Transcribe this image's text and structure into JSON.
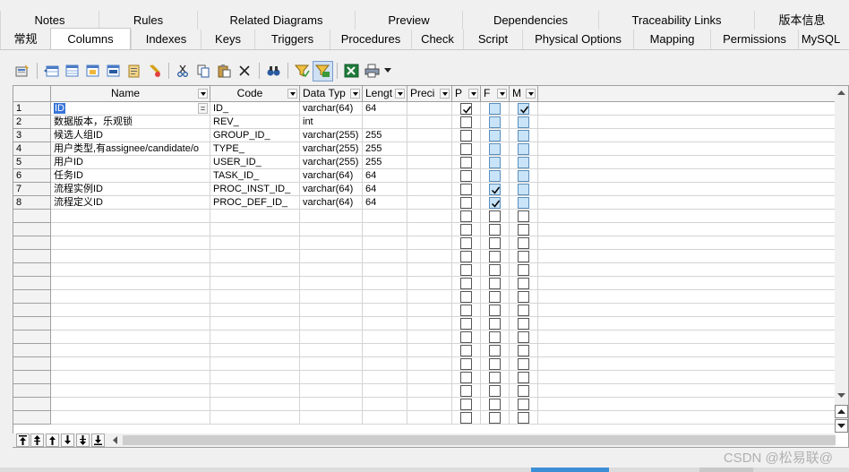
{
  "tabs_row1": [
    "Notes",
    "Rules",
    "Related Diagrams",
    "Preview",
    "Dependencies",
    "Traceability Links",
    "版本信息"
  ],
  "tabs_row2": [
    "常规",
    "Columns",
    "Indexes",
    "Keys",
    "Triggers",
    "Procedures",
    "Check",
    "Script",
    "Physical Options",
    "Mapping",
    "Permissions",
    "MySQL"
  ],
  "active_tab": "Columns",
  "toolbar_icons": [
    "properties-icon",
    "insert-row-icon",
    "add-row-icon",
    "add-columns-icon",
    "delete-columns-icon",
    "paste-special-icon",
    "clear-filter-icon",
    "cut-icon",
    "copy-icon",
    "paste-icon",
    "delete-icon",
    "find-icon",
    "filter-icon",
    "customize-columns-icon",
    "export-excel-icon",
    "print-icon",
    "print-dropdown-icon"
  ],
  "grid": {
    "headers": [
      "Name",
      "Code",
      "Data Typ",
      "Lengt",
      "Preci",
      "P",
      "F",
      "M"
    ],
    "rows": [
      {
        "num": "1",
        "name": "ID",
        "code": "ID_",
        "type": "varchar(64)",
        "length": "64",
        "p": true,
        "f": false,
        "m": true
      },
      {
        "num": "2",
        "name": "数据版本，乐观锁",
        "code": "REV_",
        "type": "int",
        "length": "",
        "p": false,
        "f": false,
        "m": false
      },
      {
        "num": "3",
        "name": "候选人组ID",
        "code": "GROUP_ID_",
        "type": "varchar(255)",
        "length": "255",
        "p": false,
        "f": false,
        "m": false
      },
      {
        "num": "4",
        "name": "用户类型,有assignee/candidate/o",
        "code": "TYPE_",
        "type": "varchar(255)",
        "length": "255",
        "p": false,
        "f": false,
        "m": false
      },
      {
        "num": "5",
        "name": "用户ID",
        "code": "USER_ID_",
        "type": "varchar(255)",
        "length": "255",
        "p": false,
        "f": false,
        "m": false
      },
      {
        "num": "6",
        "name": "任务ID",
        "code": "TASK_ID_",
        "type": "varchar(64)",
        "length": "64",
        "p": false,
        "f": false,
        "m": false
      },
      {
        "num": "7",
        "name": "流程实例ID",
        "code": "PROC_INST_ID_",
        "type": "varchar(64)",
        "length": "64",
        "p": false,
        "f": true,
        "m": false
      },
      {
        "num": "8",
        "name": "流程定义ID",
        "code": "PROC_DEF_ID_",
        "type": "varchar(64)",
        "length": "64",
        "p": false,
        "f": true,
        "m": false
      }
    ],
    "total_visible_rows": 24,
    "edit_button_label": "="
  },
  "nav_buttons": [
    "move-top-icon",
    "move-up-page-icon",
    "move-up-icon",
    "move-down-icon",
    "move-down-page-icon",
    "move-bottom-icon"
  ],
  "watermark": "CSDN @松易联@"
}
